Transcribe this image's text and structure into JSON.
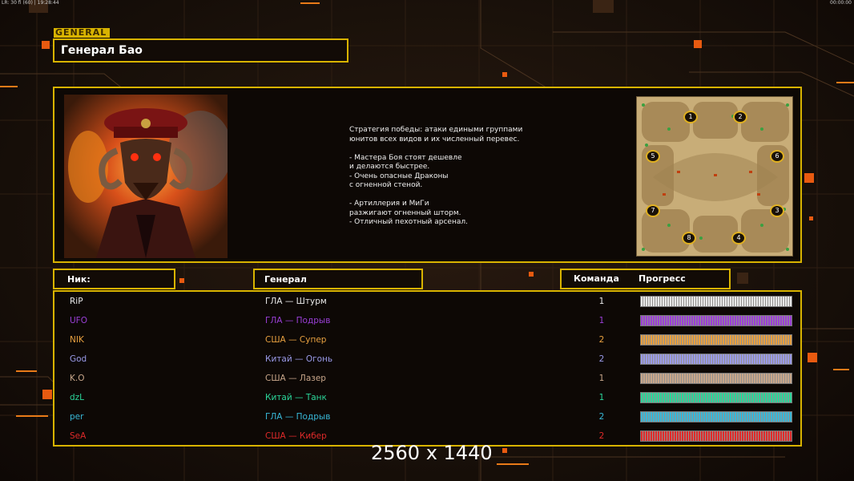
{
  "topbar": {
    "left": "LR: 30 fi (60) | 19:28:44",
    "right": "00:00:00"
  },
  "general_tag": "GENERAL",
  "general_name": "Генерал Бао",
  "strategy_lines": [
    "Стратегия победы: атаки едиными группами",
    "юнитов всех видов и их численный перевес.",
    "",
    "- Мастера Боя стоят дешевле",
    "и делаются быстрее.",
    "- Очень опасные Драконы",
    "с огненной стеной.",
    "",
    "- Артиллерия и МиГи",
    "разжигают огненный шторм.",
    "- Отличный пехотный арсенал."
  ],
  "map_slots": [
    "1",
    "2",
    "5",
    "6",
    "7",
    "3",
    "8",
    "4"
  ],
  "headers": {
    "nick": "Ник:",
    "general": "Генерал",
    "team": "Команда",
    "progress": "Прогресс"
  },
  "players": [
    {
      "nick": "RiP",
      "general": "ГЛА — Штурм",
      "team": "1",
      "color": "#e8e8e8"
    },
    {
      "nick": "UFO",
      "general": "ГЛА — Подрыв",
      "team": "1",
      "color": "#9b3fd6"
    },
    {
      "nick": "NIK",
      "general": "США — Супер",
      "team": "2",
      "color": "#e8a040"
    },
    {
      "nick": "God",
      "general": "Китай — Огонь",
      "team": "2",
      "color": "#9a9ae8"
    },
    {
      "nick": "K.O",
      "general": "США — Лазер",
      "team": "1",
      "color": "#c8a68a"
    },
    {
      "nick": "dzL",
      "general": "Китай — Танк",
      "team": "1",
      "color": "#2bd69a"
    },
    {
      "nick": "per",
      "general": "ГЛА — Подрыв",
      "team": "2",
      "color": "#38b8d8"
    },
    {
      "nick": "SeA",
      "general": "США — Кибер",
      "team": "2",
      "color": "#e02a2a"
    }
  ],
  "watermark": "2560 x 1440"
}
